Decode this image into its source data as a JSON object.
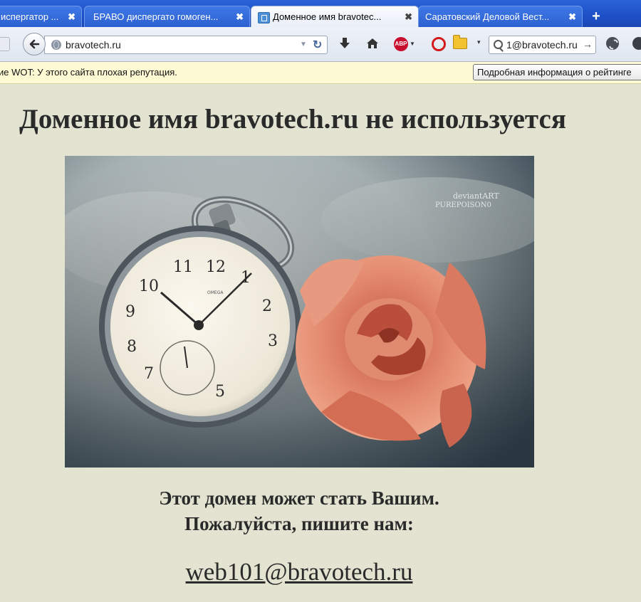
{
  "browser": {
    "tabs": [
      {
        "label": "испергатор ...",
        "active": false
      },
      {
        "label": "БРАВО диспергато гомоген...",
        "active": false
      },
      {
        "label": "Доменное имя bravotec...",
        "active": true
      },
      {
        "label": "Саратовский Деловой Вест...",
        "active": false
      }
    ],
    "tab_close_glyph": "✖",
    "new_tab_glyph": "+",
    "url": "bravotech.ru",
    "search_value": "1@bravotech.ru",
    "abp_label": "ABP",
    "toolbar_icons": [
      "download-icon",
      "home-icon",
      "adblock-icon",
      "opera-icon",
      "folder-icon",
      "search-icon",
      "sync-icon"
    ]
  },
  "wot_bar": {
    "message": "ие WOT: У этого сайта плохая репутация.",
    "details_button": "Подробная информация о рейтинге"
  },
  "page": {
    "heading": "Доменное имя bravotech.ru не используется",
    "tagline_line1": "Этот домен может стать Вашим.",
    "tagline_line2": "Пожалуйста, пишите нам:",
    "email": "web101@bravotech.ru",
    "image_watermark": "deviantART PUREPOISON0"
  },
  "colors": {
    "tabstrip": "#1d4fc7",
    "page_background": "#e3e3d2",
    "notification_bar": "#fefbd4",
    "text": "#2a2a2a",
    "rose": "#e2876c"
  }
}
